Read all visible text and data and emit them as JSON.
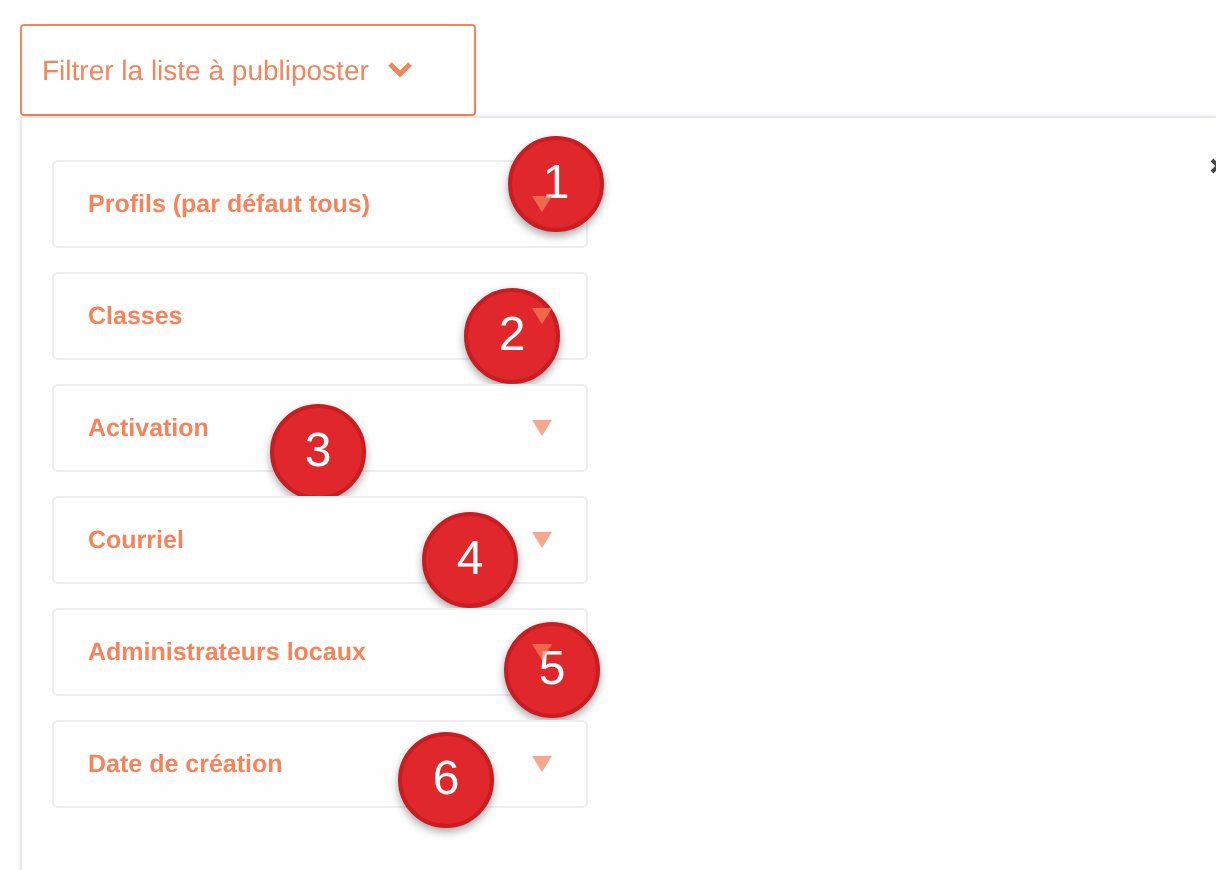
{
  "filter_button": {
    "label": "Filtrer la liste à publiposter",
    "expanded": true
  },
  "filters": [
    {
      "label": "Profils (par défaut tous)",
      "badge": "1"
    },
    {
      "label": "Classes",
      "badge": "2"
    },
    {
      "label": "Activation",
      "badge": "3"
    },
    {
      "label": "Courriel",
      "badge": "4"
    },
    {
      "label": "Administrateurs locaux",
      "badge": "5"
    },
    {
      "label": "Date de création",
      "badge": "6"
    }
  ]
}
